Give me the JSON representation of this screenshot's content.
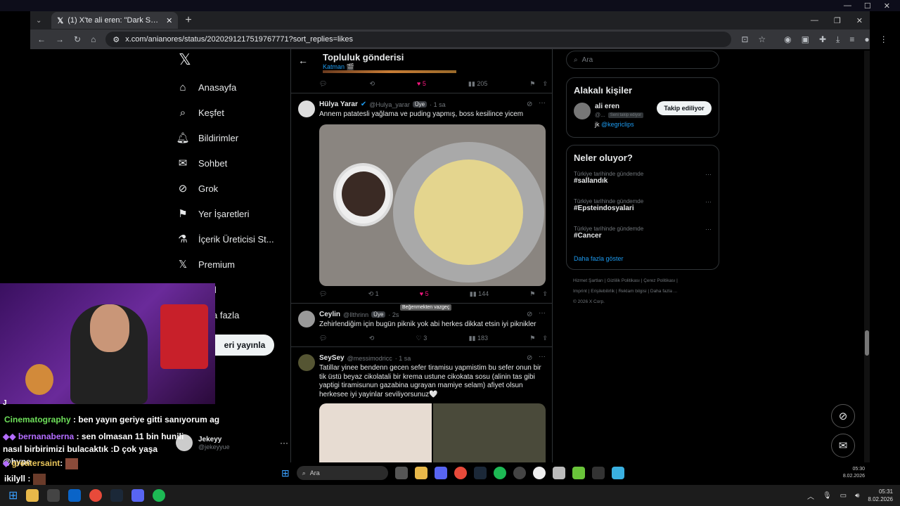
{
  "browser": {
    "tab_title": "(1) X'te ali eren: \"Dark Souls 3 ...",
    "url": "x.com/anianores/status/2020291217519767771?sort_replies=likes"
  },
  "sidebar": {
    "items": [
      "Anasayfa",
      "Keşfet",
      "Bildirimler",
      "Sohbet",
      "Grok",
      "Yer İşaretleri",
      "İçerik Üreticisi St...",
      "Premium",
      "il",
      "a fazla"
    ],
    "post_button": "eri yayınla",
    "user_name": "Jekeyy",
    "user_handle": "@jekeyyue"
  },
  "header": {
    "title": "Topluluk gönderisi",
    "subtitle": "Katman 🎬"
  },
  "top_actions": {
    "likes": "5",
    "views": "205"
  },
  "post1": {
    "name": "Hülya Yarar",
    "handle": "@Hulya_yarar",
    "badge": "Üye",
    "time": "· 1 sa",
    "text": "Annem patatesli yağlama ve puding yapmış, boss kesilince yicem",
    "retweets": "1",
    "likes": "5",
    "views": "144",
    "tooltip": "Beğenmekten vazgeç"
  },
  "post2": {
    "name": "Ceylin",
    "handle": "@Ilthrinn",
    "badge": "Üye",
    "time": "· 2s",
    "text": "Zehirlendiğim için bugün piknik yok abi herkes dikkat etsin iyi piknikler",
    "likes": "3",
    "views": "183"
  },
  "post3": {
    "name": "SeySey",
    "handle": "@messimodricc",
    "time": "· 1 sa",
    "text": "Tatillar yinee bendenn gecen sefer tiramisu yapmistim bu sefer onun bir tik üstü beyaz cikolatali bir krema ustune cikokata sosu (alinin tas gibi yaptigi tiramisunun gazabina ugrayan mamiye selam) afiyet olsun herkesee iyi yayinlar seviliyorsunuz🤍"
  },
  "search": {
    "placeholder": "Ara"
  },
  "related": {
    "title": "Alakalı kişiler",
    "name": "ali eren",
    "handle": "@...",
    "follows_you": "Seni takip ediyor",
    "button": "Takip ediliyor",
    "bio_prefix": "jk",
    "bio_link": "@kegriclips"
  },
  "trends": {
    "title": "Neler oluyor?",
    "items": [
      {
        "meta": "Türkiye tarihinde gündemde",
        "tag": "#sallandık"
      },
      {
        "meta": "Türkiye tarihinde gündemde",
        "tag": "#Epsteindosyalari"
      },
      {
        "meta": "Türkiye tarihinde gündemde",
        "tag": "#Cancer"
      }
    ],
    "show_more": "Daha fazla göster"
  },
  "footer": {
    "links": [
      "Hizmet Şartları",
      "Gizlilik Politikası",
      "Çerez Politikası",
      "Imprint",
      "Erişilebilirlik",
      "Reklam bilgisi",
      "Daha fazla ..."
    ],
    "copyright": "© 2026 X Corp."
  },
  "chat": [
    {
      "user": "Cinematography",
      "msg": ": ben yayın geriye gitti sanıyorum ag",
      "color": "#6ee05a"
    },
    {
      "user": "bernanaberna",
      "msg": ": sen olmasan 11 bin hunili nasıl birbirimizi bulacaktık :D çok yaşa @hype",
      "color": "#b36cff"
    },
    {
      "user": "greatersaint",
      "msg": ":",
      "color": "#e8c55a"
    },
    {
      "user": "ikilyll",
      "msg": ":",
      "color": "#ffffff"
    }
  ],
  "chat_prefix": "J",
  "taskbar": {
    "search": "Ara",
    "time_inner": "05:30",
    "date_inner": "8.02.2026",
    "time": "05:31",
    "date": "8.02.2026"
  }
}
